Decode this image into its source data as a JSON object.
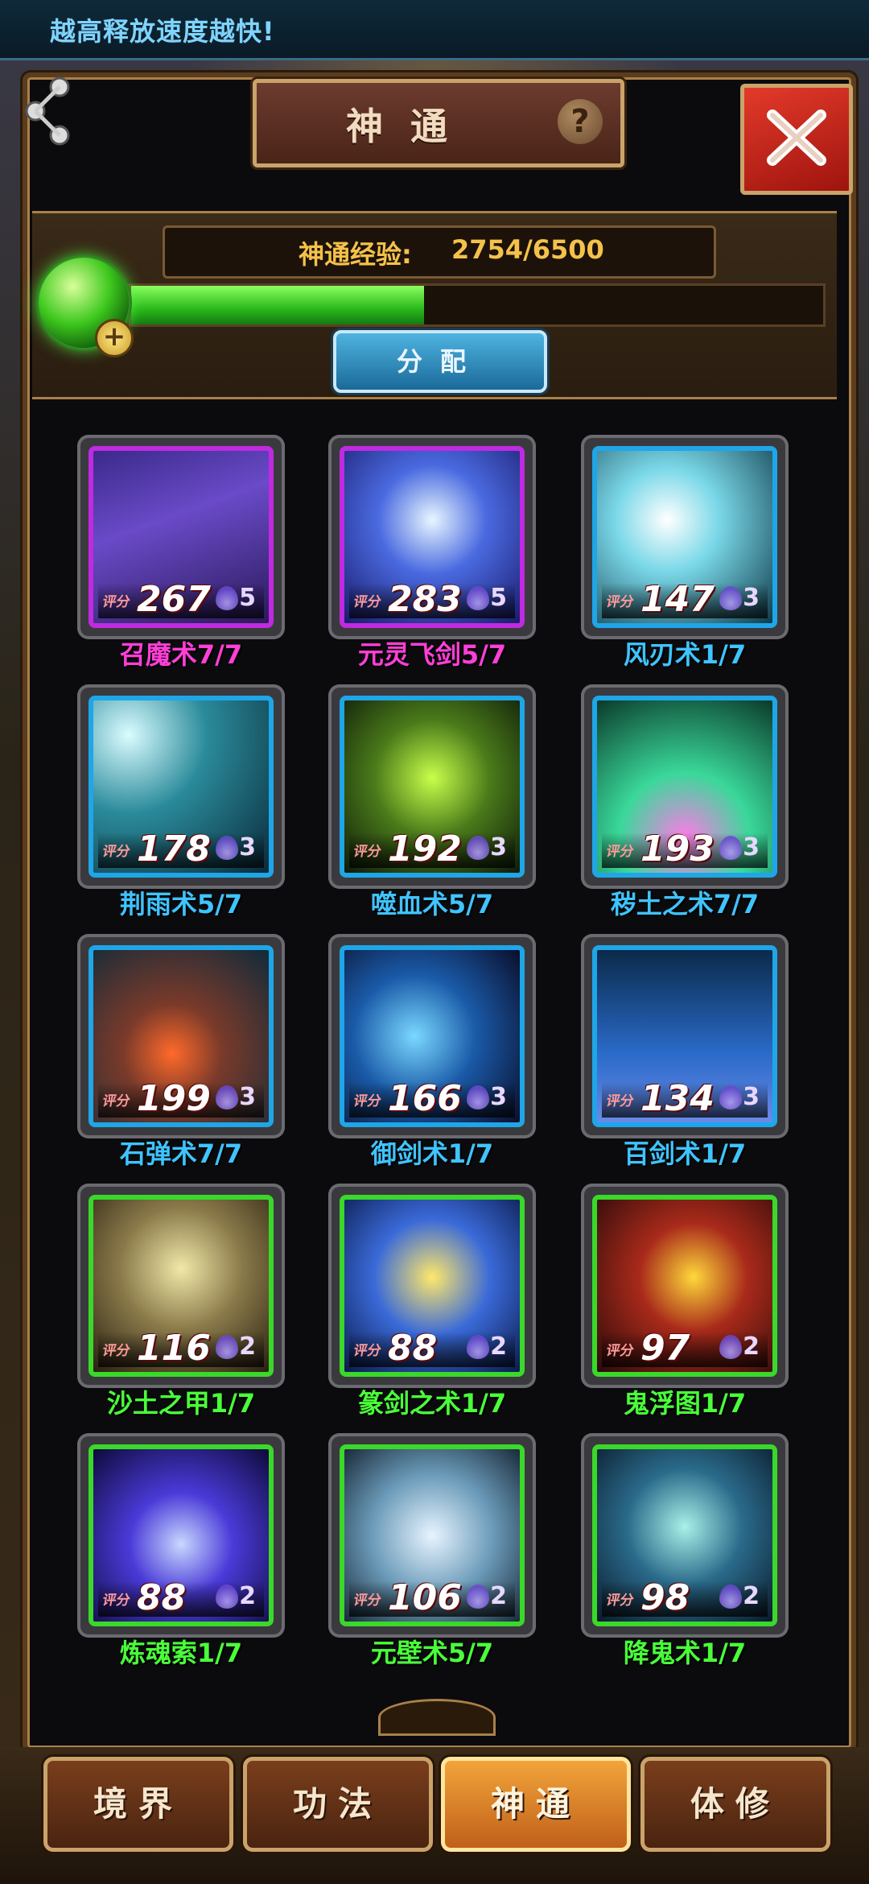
{
  "topbar": {
    "text": "越高释放速度越快!"
  },
  "panel": {
    "title": "神通",
    "help": "?",
    "exp_label": "神通经验:",
    "exp_value": "2754/6500",
    "exp_progress": 0.4237,
    "assign_label": "分配"
  },
  "skills": [
    {
      "name": "召魔术7/7",
      "score": "267",
      "level": "5",
      "name_color": "#ff3fd8",
      "frame_color": "#c02ae0",
      "art": "linear-gradient(160deg,#3a2a8a,#6a4ac8 40%,#2a1a5a)"
    },
    {
      "name": "元灵飞剑5/7",
      "score": "283",
      "level": "5",
      "name_color": "#ff3fd8",
      "frame_color": "#c02ae0",
      "art": "radial-gradient(circle at 50% 40%,#e8f6ff,#4a6ae0 40%,#1a1a6a)"
    },
    {
      "name": "风刃术1/7",
      "score": "147",
      "level": "3",
      "name_color": "#3fc4ff",
      "frame_color": "#1fa6e8",
      "art": "radial-gradient(circle at 40% 40%,#ffffff,#7ad8e8 35%,#0e3a4a)"
    },
    {
      "name": "荆雨术5/7",
      "score": "178",
      "level": "3",
      "name_color": "#3fc4ff",
      "frame_color": "#1fa6e8",
      "art": "radial-gradient(circle at 20% 20%,#dafcff,#2a8a9a 40%,#0a2a3a)"
    },
    {
      "name": "噬血术5/7",
      "score": "192",
      "level": "3",
      "name_color": "#3fc4ff",
      "frame_color": "#1fa6e8",
      "art": "radial-gradient(circle at 50% 45%,#c8ff4a,#4a7a1a 45%,#0e1a0a)"
    },
    {
      "name": "秽土之术7/7",
      "score": "193",
      "level": "3",
      "name_color": "#3fc4ff",
      "frame_color": "#1fa6e8",
      "art": "radial-gradient(circle at 50% 80%,#ff7ae8,#3ad89a 40%,#0a3a2a)"
    },
    {
      "name": "石弹术7/7",
      "score": "199",
      "level": "3",
      "name_color": "#3fc4ff",
      "frame_color": "#1fa6e8",
      "art": "radial-gradient(circle at 45% 60%,#ff6a2a,#7a3a2a 35%,#102a3a)"
    },
    {
      "name": "御剑术1/7",
      "score": "166",
      "level": "3",
      "name_color": "#3fc4ff",
      "frame_color": "#1fa6e8",
      "art": "radial-gradient(circle at 40% 50%,#7ad8ff,#1a5aa8 45%,#0a0e2a)"
    },
    {
      "name": "百剑术1/7",
      "score": "134",
      "level": "3",
      "name_color": "#3fc4ff",
      "frame_color": "#1fa6e8",
      "art": "linear-gradient(180deg,#0a2a4a,#2a6ac8 60%,#6a8ae8)"
    },
    {
      "name": "沙土之甲1/7",
      "score": "116",
      "level": "2",
      "name_color": "#4aff3a",
      "frame_color": "#3ad82a",
      "art": "radial-gradient(circle at 50% 40%,#f0e8a8,#8a7a4a 45%,#2a2010)"
    },
    {
      "name": "篆剑之术1/7",
      "score": "88",
      "level": "2",
      "name_color": "#4aff3a",
      "frame_color": "#3ad82a",
      "art": "radial-gradient(circle at 50% 45%,#ffe86a,#3a6ad8 45%,#0a1a4a)"
    },
    {
      "name": "鬼浮图1/7",
      "score": "97",
      "level": "2",
      "name_color": "#4aff3a",
      "frame_color": "#3ad82a",
      "art": "radial-gradient(circle at 55% 45%,#ffd83a,#a82a1a 40%,#2a0a0a)"
    },
    {
      "name": "炼魂索1/7",
      "score": "88",
      "level": "2",
      "name_color": "#4aff3a",
      "frame_color": "#3ad82a",
      "art": "radial-gradient(circle at 50% 55%,#c8d8ff,#4a3ad8 40%,#0e0a3a)"
    },
    {
      "name": "元壁术5/7",
      "score": "106",
      "level": "2",
      "name_color": "#4aff3a",
      "frame_color": "#3ad82a",
      "art": "radial-gradient(circle at 50% 50%,#e8f4ff,#6a9ab8 50%,#1a2a3a)"
    },
    {
      "name": "降鬼术1/7",
      "score": "98",
      "level": "2",
      "name_color": "#4aff3a",
      "frame_color": "#3ad82a",
      "art": "radial-gradient(circle at 50% 45%,#a8f0e8,#2a6a8a 45%,#0a1a2a)"
    }
  ],
  "score_tag": "评分",
  "tabs": [
    {
      "label": "境界",
      "active": false
    },
    {
      "label": "功法",
      "active": false
    },
    {
      "label": "神通",
      "active": true
    },
    {
      "label": "体修",
      "active": false
    }
  ]
}
